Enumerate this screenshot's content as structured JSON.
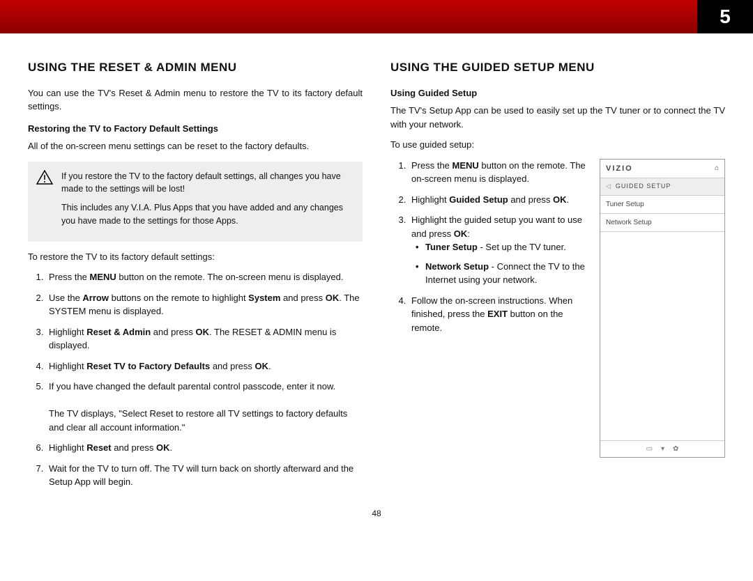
{
  "header": {
    "page_num_top": "5"
  },
  "left": {
    "h": "USING THE RESET & ADMIN MENU",
    "intro": "You can use the TV's Reset & Admin menu to restore the TV to its factory default settings.",
    "sub": "Restoring the TV to Factory Default Settings",
    "p2": "All of the on-screen menu settings can be reset to the factory defaults.",
    "warn1": "If you restore the TV to the factory default settings, all changes you have made to the settings will be lost!",
    "warn2": "This includes any V.I.A. Plus Apps that you have added and any changes you have made to the settings for those Apps.",
    "lead": "To restore the TV to its factory default settings:",
    "steps": [
      "Press the <b>MENU</b> button on the remote. The on-screen menu is displayed.",
      "Use the <b>Arrow</b> buttons on the remote to highlight <b>System</b> and press <b>OK</b>. The SYSTEM menu is displayed.",
      "Highlight <b>Reset & Admin</b> and press <b>OK</b>. The RESET & ADMIN menu is displayed.",
      "Highlight <b>Reset TV to Factory Defaults</b> and press <b>OK</b>.",
      "If you have changed the default parental control passcode, enter it now.<br><br>The TV displays, \"Select Reset to restore all TV settings to factory defaults and clear all account information.\"",
      "Highlight <b>Reset</b> and press <b>OK</b>.",
      "Wait for the TV to turn off. The TV will turn back on shortly afterward and the Setup App will begin."
    ]
  },
  "right": {
    "h": "USING THE GUIDED SETUP MENU",
    "sub": "Using Guided Setup",
    "p1": "The TV's Setup App can be used to easily set up the TV tuner or to connect the TV with your network.",
    "lead": "To use guided setup:",
    "steps": [
      "Press the <b>MENU</b> button on the remote. The on-screen menu is displayed.",
      "Highlight <b>Guided Setup</b> and press <b>OK</b>.",
      "Highlight the guided setup you want to use and press <b>OK</b>:",
      "Follow the on-screen instructions. When finished, press the <b>EXIT</b> button on the remote."
    ],
    "bul": [
      "<b>Tuner Setup</b> - Set up the TV tuner.",
      "<b>Network Setup</b> - Connect the TV to the Internet using your network."
    ]
  },
  "panel": {
    "brand": "VIZIO",
    "title": "GUIDED SETUP",
    "items": [
      "Tuner Setup",
      "Network Setup"
    ]
  },
  "footer": {
    "page": "48"
  }
}
